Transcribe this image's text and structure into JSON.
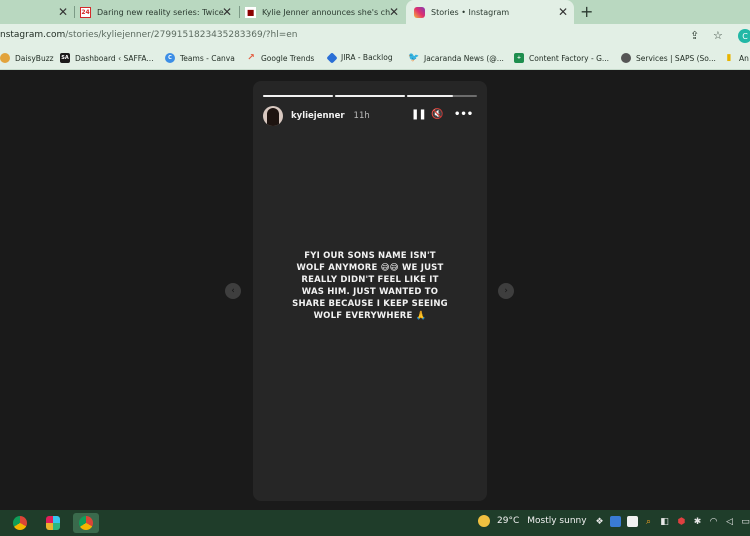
{
  "tabs": [
    {
      "title": "",
      "active": false,
      "close": "✕"
    },
    {
      "title": "Daring new reality series: Twice",
      "favicon": "24",
      "active": false,
      "close": "✕"
    },
    {
      "title": "Kylie Jenner announces she's ch",
      "favicon": "■",
      "active": false,
      "close": "✕"
    },
    {
      "title": "Stories • Instagram",
      "active": true,
      "close": "✕"
    }
  ],
  "new_tab": "+",
  "address": {
    "url_main": "nstagram.com",
    "url_rest": "/stories/kyliejenner/2799151823435283369/?hl=en"
  },
  "bookmarks": [
    {
      "label": "DaisyBuzz",
      "icon_color": "#e2a33b"
    },
    {
      "label": "Dashboard ‹ SAFFA...",
      "icon_text": "SA",
      "icon_color": "#1b1b1b"
    },
    {
      "label": "Teams - Canva",
      "icon_text": "C",
      "icon_color": "#3c8ee6"
    },
    {
      "label": "Google Trends",
      "icon_color": "#e35a3d"
    },
    {
      "label": "JIRA - Backlog",
      "icon_color": "#2a6fd6"
    },
    {
      "label": "Jacaranda News (@...",
      "icon_color": "#2b3a30"
    },
    {
      "label": "Content Factory - G...",
      "icon_color": "#1e8e4e"
    },
    {
      "label": "Services | SAPS (So...",
      "icon_color": "#555555"
    },
    {
      "label": "An",
      "icon_color": "#e8b400"
    }
  ],
  "story": {
    "username": "kyliejenner",
    "time": "11h",
    "progress": [
      1,
      1,
      0.65
    ],
    "text": "FYI OUR SONS NAME ISN'T WOLF ANYMORE 😅😅 WE JUST REALLY DIDN'T FEEL LIKE IT WAS HIM. JUST WANTED TO SHARE BECAUSE I KEEP SEEING WOLF EVERYWHERE 🙏",
    "prev_arrow": "‹",
    "next_arrow": "›"
  },
  "taskbar": {
    "temperature": "29°C",
    "weather": "Mostly sunny"
  }
}
